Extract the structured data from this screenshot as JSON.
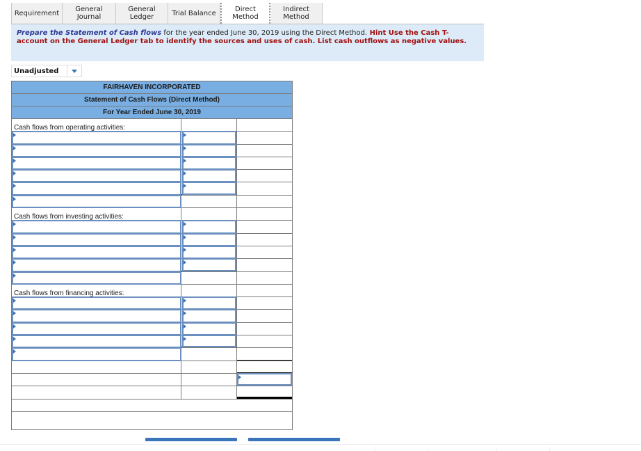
{
  "tabs": [
    {
      "label": "Requirement",
      "active": false
    },
    {
      "label": "General\nJournal",
      "active": false
    },
    {
      "label": "General\nLedger",
      "active": false
    },
    {
      "label": "Trial Balance",
      "active": false
    },
    {
      "label": "Direct Method",
      "active": true
    },
    {
      "label": "Indirect\nMethod",
      "active": false
    }
  ],
  "instructions": {
    "lead": "Prepare the Statement of Cash flows",
    "normal": " for the year ended June 30, 2019 using the Direct Method.",
    "hint": "  Hint  Use the Cash T-account on the General Ledger tab to identify the sources and uses of cash.  List cash outflows as negative values."
  },
  "dropdown": {
    "selected": "Unadjusted"
  },
  "statement": {
    "company": "FAIRHAVEN INCORPORATED",
    "title": "Statement of Cash Flows (Direct Method)",
    "period": "For Year Ended June 30, 2019",
    "sections": {
      "operating": {
        "label": "Cash flows from operating activities:",
        "input_rows": 5
      },
      "investing": {
        "label": "Cash flows from investing activities:",
        "input_rows": 4
      },
      "financing": {
        "label": "Cash flows from financing activities:",
        "input_rows": 4
      }
    },
    "inputs": {
      "operating_desc": [
        "",
        "",
        "",
        "",
        "",
        ""
      ],
      "operating_amt": [
        "",
        "",
        "",
        "",
        ""
      ],
      "investing_desc": [
        "",
        "",
        "",
        "",
        ""
      ],
      "investing_amt": [
        "",
        "",
        "",
        ""
      ],
      "financing_desc": [
        "",
        "",
        "",
        "",
        ""
      ],
      "financing_amt": [
        "",
        "",
        "",
        ""
      ],
      "net_change": ""
    }
  },
  "colors": {
    "header_blue": "#79aee3",
    "input_border": "#6b8fbf",
    "hint_red": "#a01010",
    "lead_blue": "#2e3a94",
    "instructions_bg": "#dcebf7",
    "nav_button": "#3a74b9"
  }
}
